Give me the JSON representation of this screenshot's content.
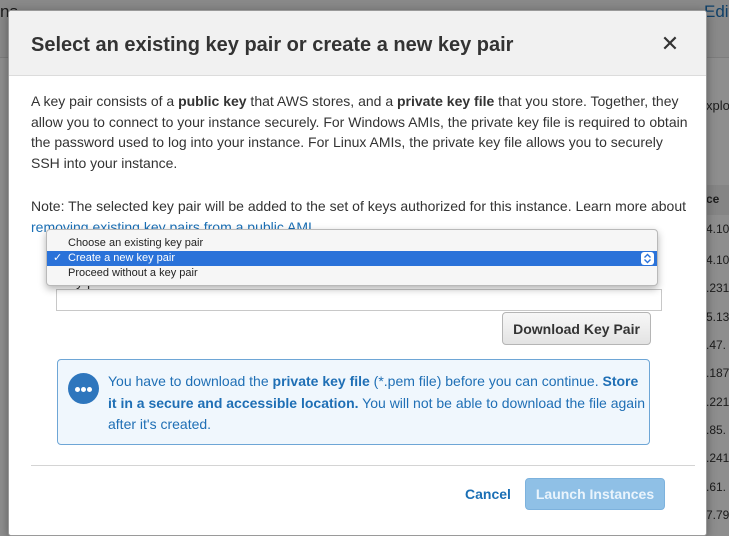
{
  "background": {
    "top_left_text": "ns",
    "top_right_link": "Edit",
    "side_text": "xplor",
    "column_header": "ce",
    "rows": [
      "4.10",
      "4.10",
      ".231",
      "5.13",
      ".47.",
      ".187",
      ".221",
      ".85.",
      ".241",
      ".61.",
      "7.79"
    ]
  },
  "modal": {
    "title": "Select an existing key pair or create a new key pair",
    "close_glyph": "✕",
    "description": {
      "p1": "A key pair consists of a ",
      "b1": "public key",
      "p2": " that AWS stores, and a ",
      "b2": "private key file",
      "p3": " that you store. Together, they allow you to connect to your instance securely. For Windows AMIs, the private key file is required to obtain the password used to log into your instance. For Linux AMIs, the private key file allows you to securely SSH into your instance."
    },
    "note": {
      "text": "Note: The selected key pair will be added to the set of keys authorized for this instance. Learn more about ",
      "link": "removing existing key pairs from a public AMI",
      "end": "."
    },
    "key_select": {
      "options": [
        "Choose an existing key pair",
        "Create a new key pair",
        "Proceed without a key pair"
      ],
      "selected": "Create a new key pair",
      "check_glyph": "✓"
    },
    "key_name_label": "Key pair name",
    "key_name_value": "",
    "download_button": "Download Key Pair",
    "info": {
      "t1": "You have to download the ",
      "b1": "private key file",
      "t2": " (*.pem file) before you can continue. ",
      "b2": "Store it in a secure and accessible location.",
      "t3": " You will not be able to download the file again after it's created."
    },
    "cancel_label": "Cancel",
    "launch_label": "Launch Instances"
  },
  "colors": {
    "link": "#1a6fb5",
    "selected_option": "#2a72d9",
    "info_border": "#6ea6d6",
    "launch_disabled": "#8fc0e6"
  }
}
